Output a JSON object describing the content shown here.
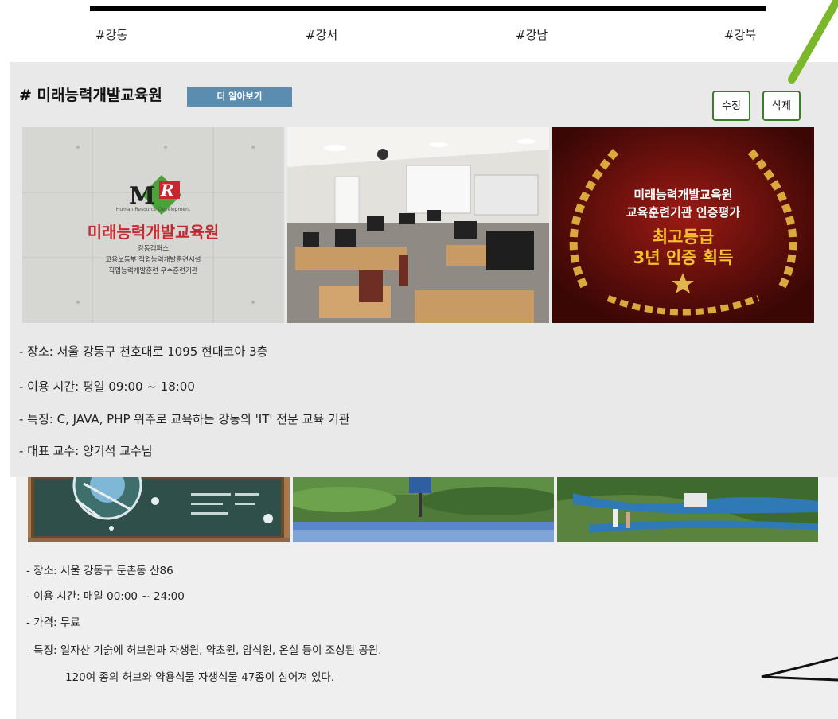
{
  "tags": [
    "#강동",
    "#강서",
    "#강남",
    "#강북"
  ],
  "card1": {
    "title": "# 미래능력개발교육원",
    "more_button": "더 알아보기",
    "edit_button": "수정",
    "delete_button": "삭제",
    "photo1": {
      "logo_sub": "Human Resource Development",
      "name": "미래능력개발교육원",
      "campus": "강동캠퍼스",
      "line1": "고용노동부 직업능력개발훈련시설",
      "line2": "직업능력개발훈련 우수훈련기관"
    },
    "photo3": {
      "line1": "미래능력개발교육원",
      "line2": "교육훈련기관 인증평가",
      "line3": "최고등급",
      "line4": "3년 인증 획득"
    },
    "info": [
      "- 장소: 서울 강동구 천호대로 1095 현대코아 3층",
      "- 이용 시간: 평일 09:00 ~ 18:00",
      "- 특징: C, JAVA, PHP 위주로 교육하는 강동의 'IT' 전문 교육 기관",
      "- 대표 교수: 양기석 교수님"
    ]
  },
  "card2": {
    "info": [
      "- 장소: 서울 강동구 둔촌동 산86",
      "- 이용 시간: 매일 00:00 ~ 24:00",
      "- 가격: 무료",
      "- 특징: 일자산 기슭에 허브원과 자생원, 약초원, 암석원, 온실 등이 조성된 공원.",
      "120여 종의 허브와 약용식물 자생식물 47종이 심어져 있다."
    ]
  },
  "colors": {
    "card_bg": "#e9e9e9",
    "accent_button": "#5b8db1",
    "button_border": "#3c7c2a",
    "annotation_green": "#7ab829"
  }
}
